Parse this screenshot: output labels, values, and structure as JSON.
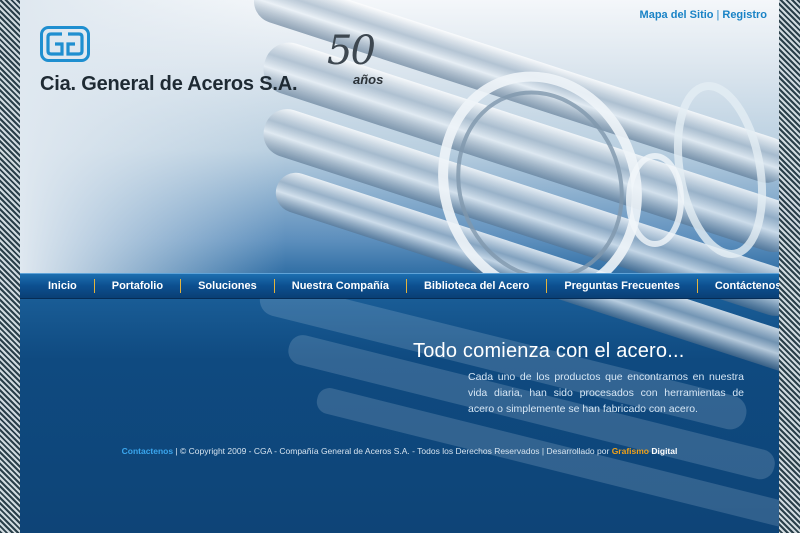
{
  "top_links": {
    "sitemap": "Mapa del Sitio",
    "separator": "|",
    "register": "Registro"
  },
  "brand": {
    "company_name": "Cia. General de Aceros S.A.",
    "anniversary_number": "50",
    "anniversary_word": "años"
  },
  "nav": {
    "items": [
      {
        "label": "Inicio"
      },
      {
        "label": "Portafolio"
      },
      {
        "label": "Soluciones"
      },
      {
        "label": "Nuestra Compañía"
      },
      {
        "label": "Biblioteca del Acero"
      },
      {
        "label": "Preguntas Frecuentes"
      },
      {
        "label": "Contáctenos"
      }
    ]
  },
  "main": {
    "headline": "Todo comienza con el acero...",
    "intro": "Cada uno de los productos que encontramos en nuestra vida diaria, han sido procesados con herramientas de acero o simplemente se han fabricado con acero."
  },
  "footer": {
    "contact_link": "Contactenos",
    "copyright": " | © Copyright 2009 - CGA - Compañía General de Aceros S.A. - Todos los Derechos Reservados | Desarrollado por ",
    "developer_part1": "Grafismo",
    "developer_part2": " Digital"
  },
  "colors": {
    "accent_link": "#1a83c6",
    "nav_separator": "#e3b33d",
    "developer_orange": "#f0a21a"
  },
  "icons": [
    "cga-logo-icon",
    "fifty-years-emblem"
  ]
}
